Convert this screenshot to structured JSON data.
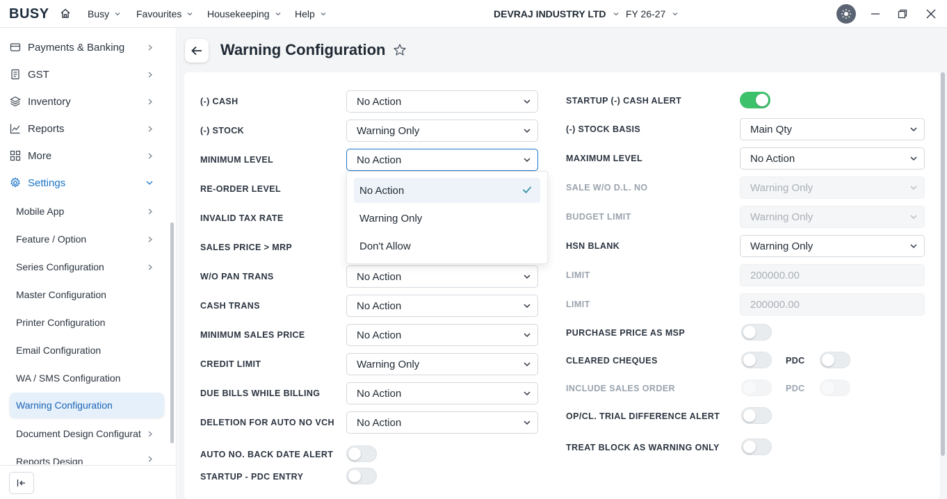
{
  "app": {
    "logo": "BUSY",
    "menu": [
      "Busy",
      "Favourites",
      "Housekeeping",
      "Help"
    ],
    "company": "DEVRAJ INDUSTRY LTD",
    "fy": "FY 26-27"
  },
  "sidebar": {
    "top_items": [
      "Payments & Banking",
      "GST",
      "Inventory",
      "Reports",
      "More",
      "Settings"
    ],
    "settings_items": [
      "Mobile App",
      "Feature / Option",
      "Series Configuration",
      "Master Configuration",
      "Printer Configuration",
      "Email Configuration",
      "WA / SMS Configuration",
      "Warning Configuration",
      "Document Design Configurat",
      "Reports Design"
    ]
  },
  "page": {
    "title": "Warning Configuration"
  },
  "left": {
    "cash": {
      "label": "(-) CASH",
      "value": "No Action"
    },
    "stock": {
      "label": "(-) STOCK",
      "value": "Warning Only"
    },
    "min_level": {
      "label": "MINIMUM LEVEL",
      "value": "No Action"
    },
    "reorder": {
      "label": "RE-ORDER LEVEL"
    },
    "invalid_tax": {
      "label": "INVALID TAX RATE"
    },
    "sales_price_mrp": {
      "label": "SALES PRICE > MRP"
    },
    "wo_pan": {
      "label": "W/O PAN TRANS",
      "value": "No Action"
    },
    "cash_trans": {
      "label": "CASH TRANS",
      "value": "No Action"
    },
    "min_sales_price": {
      "label": "MINIMUM SALES PRICE",
      "value": "No Action"
    },
    "credit_limit": {
      "label": "CREDIT LIMIT",
      "value": "Warning Only"
    },
    "due_bills": {
      "label": "DUE BILLS WHILE BILLING",
      "value": "No Action"
    },
    "deletion_auto": {
      "label": "DELETION FOR AUTO NO VCH",
      "value": "No Action"
    },
    "auto_back_date": {
      "label": "AUTO NO. BACK DATE ALERT",
      "on": false
    },
    "startup_pdc": {
      "label": "STARTUP - PDC ENTRY",
      "on": false
    }
  },
  "right": {
    "startup_cash": {
      "label": "STARTUP (-) CASH ALERT",
      "on": true
    },
    "stock_basis": {
      "label": "(-) STOCK BASIS",
      "value": "Main Qty"
    },
    "max_level": {
      "label": "MAXIMUM LEVEL",
      "value": "No Action"
    },
    "sale_wo_dl": {
      "label": "SALE W/O D.L. NO",
      "value": "Warning Only"
    },
    "budget_limit": {
      "label": "BUDGET LIMIT",
      "value": "Warning Only"
    },
    "hsn_blank": {
      "label": "HSN BLANK",
      "value": "Warning Only"
    },
    "limit1": {
      "label": "LIMIT",
      "value": "200000.00"
    },
    "limit2": {
      "label": "LIMIT",
      "value": "200000.00"
    },
    "purchase_msp": {
      "label": "PURCHASE PRICE AS MSP",
      "on": false
    },
    "cleared_cheques": {
      "label": "CLEARED CHEQUES",
      "pdc_label": "PDC"
    },
    "include_sales_order": {
      "label": "INCLUDE SALES ORDER",
      "pdc_label": "PDC"
    },
    "opcl_trial": {
      "label": "OP/CL. TRIAL DIFFERENCE ALERT"
    },
    "treat_block": {
      "label": "TREAT BLOCK AS WARNING ONLY"
    }
  },
  "dropdown": {
    "options": [
      "No Action",
      "Warning Only",
      "Don't Allow"
    ],
    "selected": "No Action"
  },
  "colors": {
    "accent": "#1a73c7",
    "toggle_on": "#3ec16b"
  }
}
